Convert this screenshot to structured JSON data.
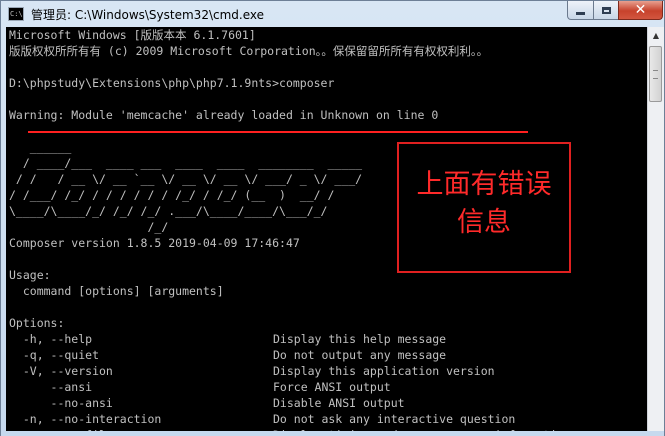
{
  "window": {
    "title": "管理员: C:\\Windows\\System32\\cmd.exe",
    "icon": "cmd-app-icon",
    "controls": {
      "minimize": "minimize-icon",
      "maximize": "maximize-icon",
      "close": "✕"
    }
  },
  "console": {
    "lines": {
      "l1": "Microsoft Windows [版版本本 6.1.7601]",
      "l2": "版版权权所所有有 (c) 2009 Microsoft Corporation。。保保留留所所有有权权利利。。",
      "l3": "",
      "l4": "D:\\phpstudy\\Extensions\\php\\php7.1.9nts>composer",
      "l5": "",
      "l6": "Warning: Module 'memcache' already loaded in Unknown on line 0",
      "l7": "",
      "l8": "",
      "l9": "",
      "l10": "",
      "l11": "",
      "l12": "",
      "l13": "Composer version 1.8.5 2019-04-09 17:46:47",
      "l14": "",
      "l15": "Usage:",
      "l16": "  command [options] [arguments]",
      "l17": "",
      "l18": "Options:"
    },
    "logo": {
      "a1": "   ______",
      "a2": "  / ____/___  ____ ___  ____  ____  ________  _____",
      "a3": " / /   / __ \\/ __ `__ \\/ __ \\/ __ \\/ ___/ _ \\/ ___/",
      "a4": "/ /___/ /_/ / / / / / / /_/ / /_/ (__  )  __/ /",
      "a5": "\\____/\\____/_/ /_/ /_/ .___/\\____/____/\\___/_/",
      "a6": "                    /_/"
    },
    "options": [
      {
        "flag": "  -h, --help",
        "desc": "Display this help message"
      },
      {
        "flag": "  -q, --quiet",
        "desc": "Do not output any message"
      },
      {
        "flag": "  -V, --version",
        "desc": "Display this application version"
      },
      {
        "flag": "      --ansi",
        "desc": "Force ANSI output"
      },
      {
        "flag": "      --no-ansi",
        "desc": "Disable ANSI output"
      },
      {
        "flag": "  -n, --no-interaction",
        "desc": "Do not ask any interactive question"
      },
      {
        "flag": "      --profile",
        "desc": "Display timing and memory usage information"
      }
    ]
  },
  "annotation": {
    "line1": "上面有错误",
    "line2": "信息",
    "color": "#ff2a2a"
  },
  "scrollbar": {
    "up_arrow": "▲",
    "position": 0.0
  }
}
